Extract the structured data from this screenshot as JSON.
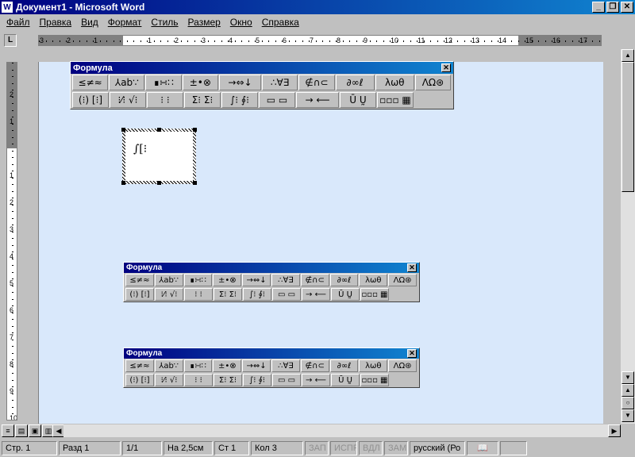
{
  "window": {
    "title": "Документ1 - Microsoft Word",
    "app_icon": "W",
    "minimize": "_",
    "maximize": "❐",
    "close": "✕"
  },
  "menu": [
    "Файл",
    "Правка",
    "Вид",
    "Формат",
    "Стиль",
    "Размер",
    "Окно",
    "Справка"
  ],
  "ruler": {
    "tab_selector": "L",
    "numbers": [
      "3",
      "2",
      "1",
      "1",
      "2",
      "3",
      "4",
      "5",
      "6",
      "7",
      "8",
      "9",
      "10",
      "11",
      "12",
      "13",
      "14",
      "15",
      "16",
      "17"
    ],
    "vnumbers": [
      "2",
      "1",
      "1",
      "2",
      "3",
      "4",
      "5",
      "6",
      "7",
      "8",
      "9",
      "10"
    ]
  },
  "formula_toolbar": {
    "title": "Формула",
    "close": "✕",
    "row1": [
      "≤≠≈",
      "⅄ab∵",
      "∎∺∷",
      "±•⊗",
      "→⇔↓",
      "∴∀∃",
      "∉∩⊂",
      "∂∞ℓ",
      "λωθ",
      "ΛΩ⊛"
    ],
    "row2": [
      "(⁝) [⁝]",
      "⁝⁄⁝ √⁝",
      "⁝ ⁝",
      "Σ⁝ Σ⁝",
      "∫⁝ ∮⁝",
      "▭ ▭",
      "→ ⟵",
      "Ū Ṵ",
      "▫▫▫ ▦"
    ]
  },
  "equation": {
    "content": "∫[⁝"
  },
  "view_buttons": [
    "≡",
    "▤",
    "▣",
    "▥"
  ],
  "status": {
    "page": "Стр. 1",
    "section": "Разд 1",
    "pages": "1/1",
    "at": "На 2,5см",
    "line": "Ст 1",
    "col": "Кол 3",
    "rec": "ЗАП",
    "trk": "ИСПР",
    "ext": "ВДЛ",
    "ovr": "ЗАМ",
    "lang": "русский (Ро",
    "book_icon": "📖"
  }
}
